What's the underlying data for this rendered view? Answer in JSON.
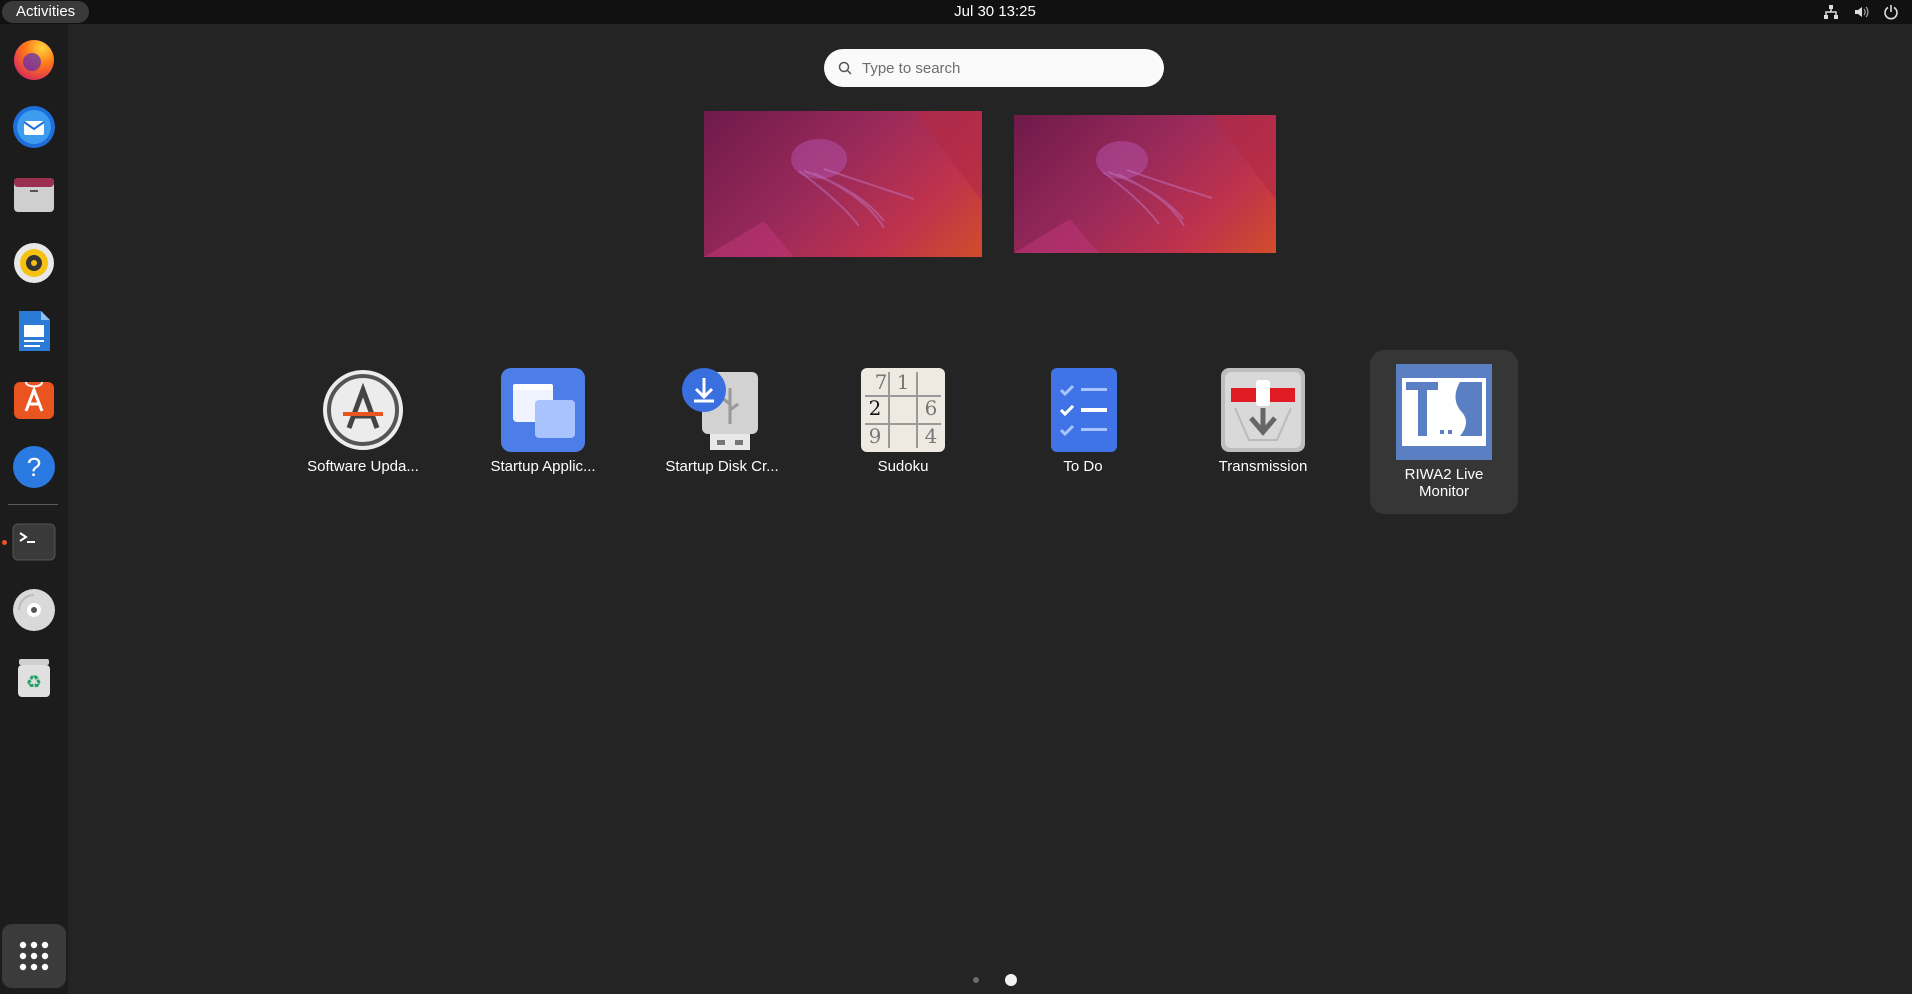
{
  "topbar": {
    "activities_label": "Activities",
    "clock": "Jul 30  13:25",
    "tray": [
      "network-icon",
      "volume-icon",
      "power-icon"
    ]
  },
  "dock": {
    "items": [
      {
        "name": "firefox",
        "icon": "firefox-icon"
      },
      {
        "name": "thunderbird",
        "icon": "thunderbird-icon"
      },
      {
        "name": "files",
        "icon": "files-icon"
      },
      {
        "name": "rhythmbox",
        "icon": "rhythmbox-icon"
      },
      {
        "name": "writer",
        "icon": "writer-icon"
      },
      {
        "name": "app-center",
        "icon": "app-center-icon"
      },
      {
        "name": "help",
        "icon": "help-icon"
      },
      {
        "name": "terminal",
        "icon": "terminal-icon",
        "running": true
      },
      {
        "name": "disc",
        "icon": "disc-icon"
      },
      {
        "name": "trash",
        "icon": "trash-icon"
      }
    ],
    "show_apps": "show-apps-icon"
  },
  "search": {
    "placeholder": "Type to search"
  },
  "apps": [
    {
      "label": "Software Upda...",
      "icon": "software-updater-icon"
    },
    {
      "label": "Startup Applic...",
      "icon": "startup-applications-icon"
    },
    {
      "label": "Startup Disk Cr...",
      "icon": "startup-disk-creator-icon"
    },
    {
      "label": "Sudoku",
      "icon": "sudoku-icon",
      "digits": [
        "7",
        "1",
        "2",
        "6",
        "9",
        "4"
      ]
    },
    {
      "label": "To Do",
      "icon": "todo-icon"
    },
    {
      "label": "Transmission",
      "icon": "transmission-icon"
    },
    {
      "label": "RIWA2 Live Monitor",
      "icon": "riwa2-monitor-icon",
      "selected": true,
      "icon_text": "T..S"
    }
  ],
  "pages": {
    "count": 2,
    "current": 2
  }
}
